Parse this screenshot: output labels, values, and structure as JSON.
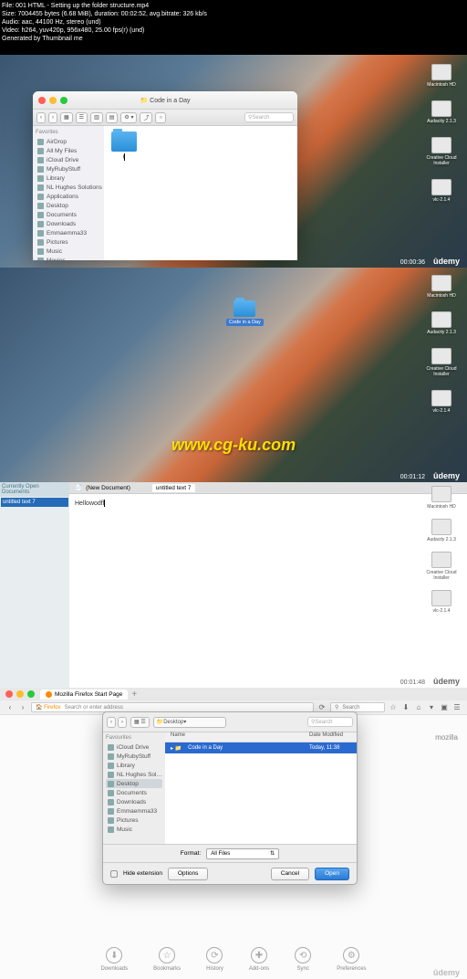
{
  "metadata": {
    "line1": "File: 001 HTML - Setting up the folder structure.mp4",
    "line2": "Size: 7004455 bytes (6.68 MiB), duration: 00:02:52, avg.bitrate: 326 kb/s",
    "line3": "Audio: aac, 44100 Hz, stereo (und)",
    "line4": "Video: h264, yuv420p, 956x480, 25.00 fps(r) (und)",
    "line5": "Generated by Thumbnail me"
  },
  "finder1": {
    "title": "Code in a Day",
    "search_ph": "Search",
    "sidebar_head": "Favorites",
    "sidebar": [
      "AirDrop",
      "All My Files",
      "iCloud Drive",
      "MyRubyStuff",
      "Library",
      "NL Hughes Solutions",
      "Applications",
      "Desktop",
      "Documents",
      "Downloads",
      "Emmaemma33",
      "Pictures",
      "Music",
      "Movies"
    ],
    "folder_name": "I"
  },
  "desktop": {
    "icons": [
      "Macintosh HD",
      "Audacity 2.1.3",
      "Creative Cloud Installer",
      "vlc-2.1.4"
    ],
    "selected_folder": "Code in a Day"
  },
  "editor": {
    "title": "(New Document)",
    "tab": "untitled text 7",
    "sidebar_title": "Currently Open Documents",
    "sidebar_item": "untitled text 7",
    "content": "Hellowodfl"
  },
  "browser": {
    "tab": "Mozilla Firefox Start Page",
    "url_ph": "Search or enter address",
    "search_ph": "Search",
    "brand": "mozilla",
    "toolbar": [
      "Downloads",
      "Bookmarks",
      "History",
      "Add-ons",
      "Sync",
      "Preferences"
    ]
  },
  "dialog": {
    "location": "Desktop",
    "search_ph": "Search",
    "col1": "Name",
    "col2": "Date Modified",
    "row_name": "Code in a Day",
    "row_date": "Today, 11:38",
    "sidebar_head": "Favourites",
    "sidebar": [
      "iCloud Drive",
      "MyRubyStuff",
      "Library",
      "NL Hughes Sol…",
      "Desktop",
      "Documents",
      "Downloads",
      "Emmaemma33",
      "Pictures",
      "Music"
    ],
    "format_label": "Format:",
    "format_value": "All Files",
    "hide_ext": "Hide extension",
    "options": "Options",
    "cancel": "Cancel",
    "open": "Open"
  },
  "watermark": "www.cg-ku.com",
  "udemy": "ûdemy",
  "times": [
    "00:00:36",
    "00:01:12",
    "00:01:48"
  ]
}
